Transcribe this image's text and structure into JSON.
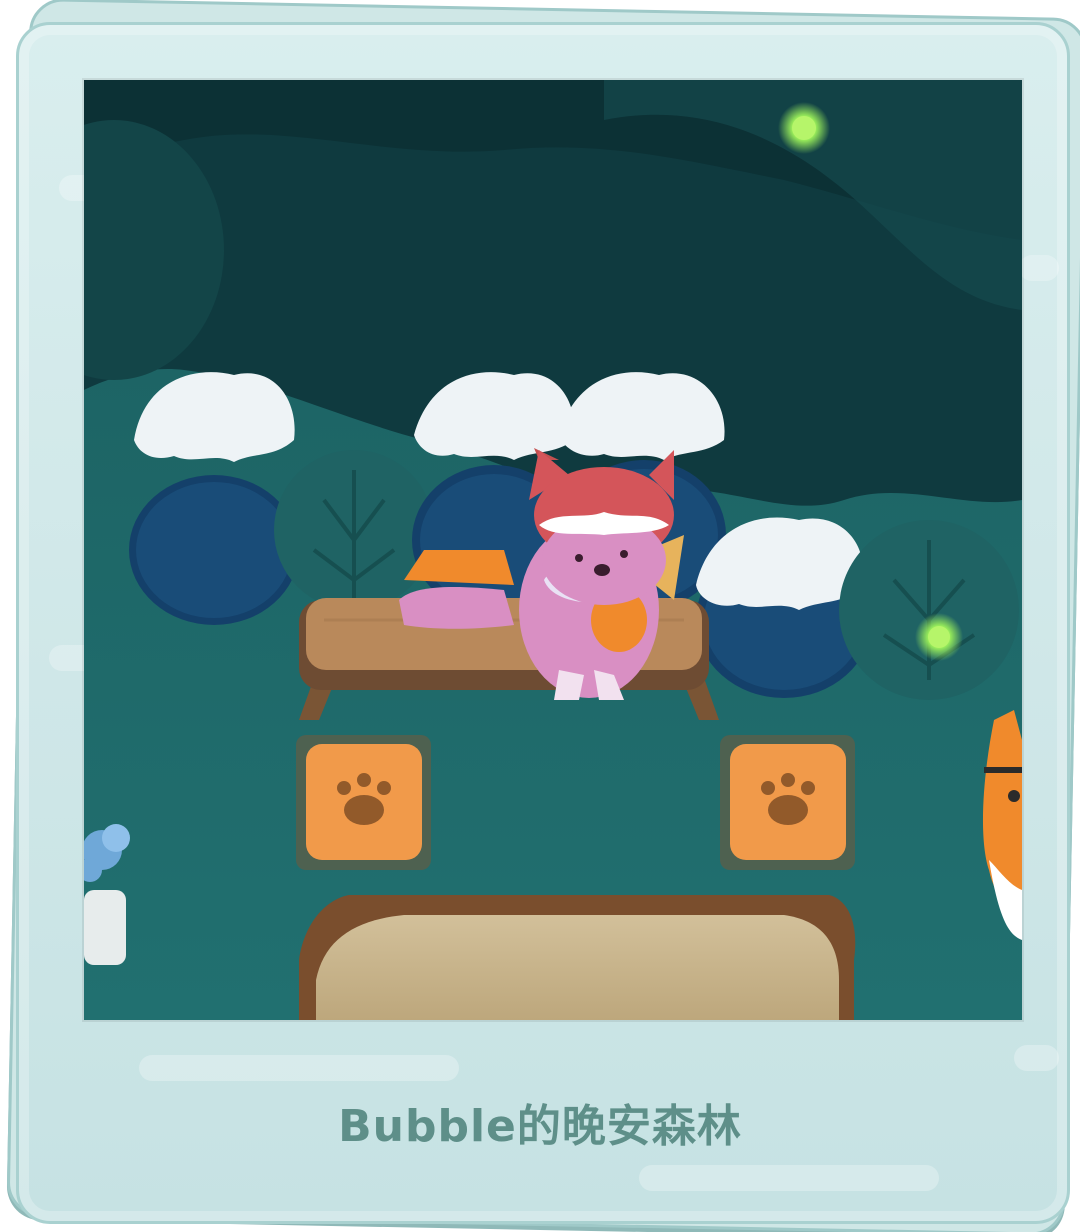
{
  "photo_card": {
    "caption": "Bubble的晚安森林"
  },
  "scene": {
    "description_icons": [
      "snow-bush-icon",
      "bush-icon",
      "firefly-icon",
      "bench-icon",
      "paw-cushion-icon",
      "rug-icon",
      "pink-dog-character-icon",
      "shiba-character-icon",
      "potted-flower-icon"
    ]
  },
  "colors": {
    "card_bg": "#d3eaea",
    "card_border": "#a9d1d0",
    "caption": "#5e8f89",
    "night_sky": "#0f3a3f",
    "forest_floor": "#1f6a6a",
    "firefly": "#9bf05a",
    "cushion": "#f19a4a",
    "bench": "#b9895b",
    "rug": "#c9b58e",
    "dog_pink": "#d98fc3",
    "hat_red": "#d4555a"
  }
}
